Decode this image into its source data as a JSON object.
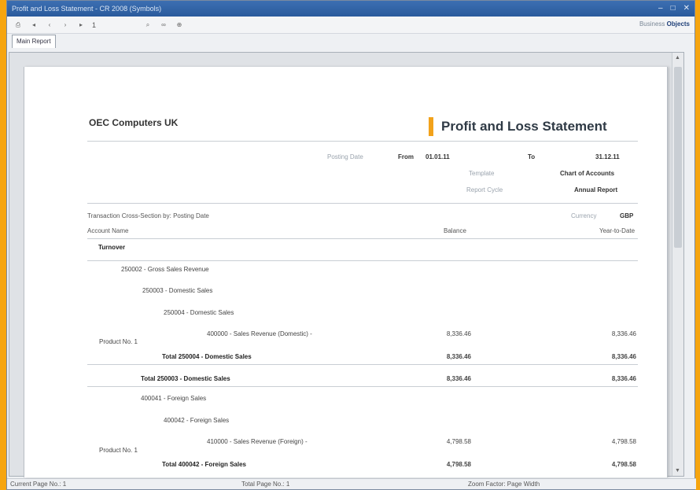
{
  "window": {
    "title": "Profit and Loss Statement - CR 2008 (Symbols)",
    "controls": [
      "–",
      "□",
      "✕"
    ]
  },
  "toolbar": {
    "page_value": "1",
    "brand_prefix": "Business",
    "brand_name": "Objects"
  },
  "tabs": [
    {
      "label": "Main Report"
    }
  ],
  "report": {
    "company": "OEC Computers UK",
    "title": "Profit and Loss Statement",
    "posting_date_label": "Posting Date",
    "from_label": "From",
    "from_value": "01.01.11",
    "to_label": "To",
    "to_value": "31.12.11",
    "template_label": "Template",
    "template_value": "Chart of Accounts",
    "cycle_label": "Report Cycle",
    "cycle_value": "Annual Report",
    "cross_section": "Transaction Cross-Section by: Posting Date",
    "currency_label": "Currency",
    "currency_value": "GBP",
    "columns": {
      "account": "Account Name",
      "balance": "Balance",
      "ytd": "Year-to-Date"
    },
    "rows": [
      {
        "name": "Turnover",
        "product": "",
        "balance": "",
        "ytd": ""
      },
      {
        "name": "250002 - Gross Sales Revenue",
        "product": "",
        "balance": "",
        "ytd": ""
      },
      {
        "name": "250003 - Domestic Sales",
        "product": "",
        "balance": "",
        "ytd": ""
      },
      {
        "name": "250004 - Domestic Sales",
        "product": "",
        "balance": "",
        "ytd": ""
      },
      {
        "name": "400000 - Sales Revenue (Domestic) -",
        "product": "Product No. 1",
        "balance": "8,336.46",
        "ytd": "8,336.46"
      },
      {
        "name": "Total 250004 - Domestic Sales",
        "product": "",
        "balance": "8,336.46",
        "ytd": "8,336.46"
      },
      {
        "name": "Total 250003 - Domestic Sales",
        "product": "",
        "balance": "8,336.46",
        "ytd": "8,336.46"
      },
      {
        "name": "400041 - Foreign Sales",
        "product": "",
        "balance": "",
        "ytd": ""
      },
      {
        "name": "400042 - Foreign Sales",
        "product": "",
        "balance": "",
        "ytd": ""
      },
      {
        "name": "410000 - Sales Revenue (Foreign) -",
        "product": "Product No. 1",
        "balance": "4,798.58",
        "ytd": "4,798.58"
      },
      {
        "name": "Total 400042 - Foreign Sales",
        "product": "",
        "balance": "4,798.58",
        "ytd": "4,798.58"
      }
    ]
  },
  "status": {
    "current_page": "Current Page No.: 1",
    "total_page": "Total Page No.: 1",
    "zoom": "Zoom Factor: Page Width"
  }
}
